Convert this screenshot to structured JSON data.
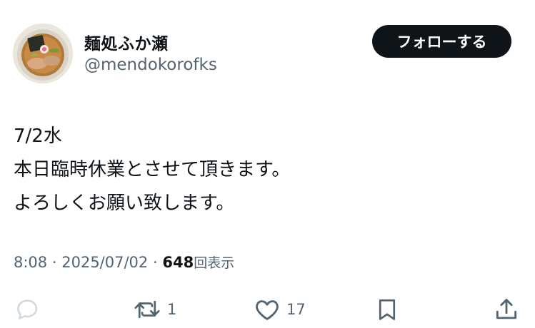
{
  "user": {
    "display_name": "麺処ふか瀬",
    "handle": "@mendokorofks"
  },
  "follow_button": {
    "label": "フォローする"
  },
  "tweet": {
    "lines": [
      "7/2水",
      "本日臨時休業とさせて頂きます。",
      "よろしくお願い致します。"
    ],
    "time": "8:08",
    "separator": "·",
    "date": "2025/07/02",
    "views_count": "648",
    "views_label": "回表示"
  },
  "actions": {
    "reply": {
      "icon": "reply-icon"
    },
    "retweet": {
      "icon": "retweet-icon",
      "count": "1"
    },
    "like": {
      "icon": "heart-icon",
      "count": "17"
    },
    "bookmark": {
      "icon": "bookmark-icon"
    },
    "share": {
      "icon": "share-icon"
    }
  },
  "colors": {
    "text": "#0f1419",
    "secondary": "#536471",
    "reply_icon": "#cfd9de",
    "button_bg": "#0f1419"
  }
}
